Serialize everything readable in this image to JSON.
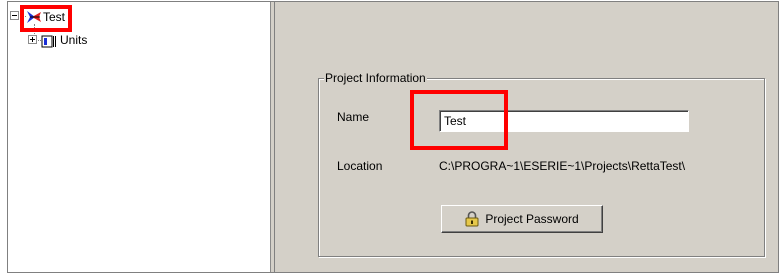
{
  "tree": {
    "root": {
      "label": "Test",
      "expander": "minus"
    },
    "children": [
      {
        "label": "Units",
        "expander": "plus"
      }
    ]
  },
  "project_info": {
    "group_title": "Project Information",
    "name_label": "Name",
    "name_value": "Test",
    "location_label": "Location",
    "location_value": "C:\\PROGRA~1\\ESERIE~1\\Projects\\RettaTest\\",
    "password_button_label": "Project Password"
  },
  "highlight_color": "#ff0000",
  "panel_color": "#d4d0c8"
}
